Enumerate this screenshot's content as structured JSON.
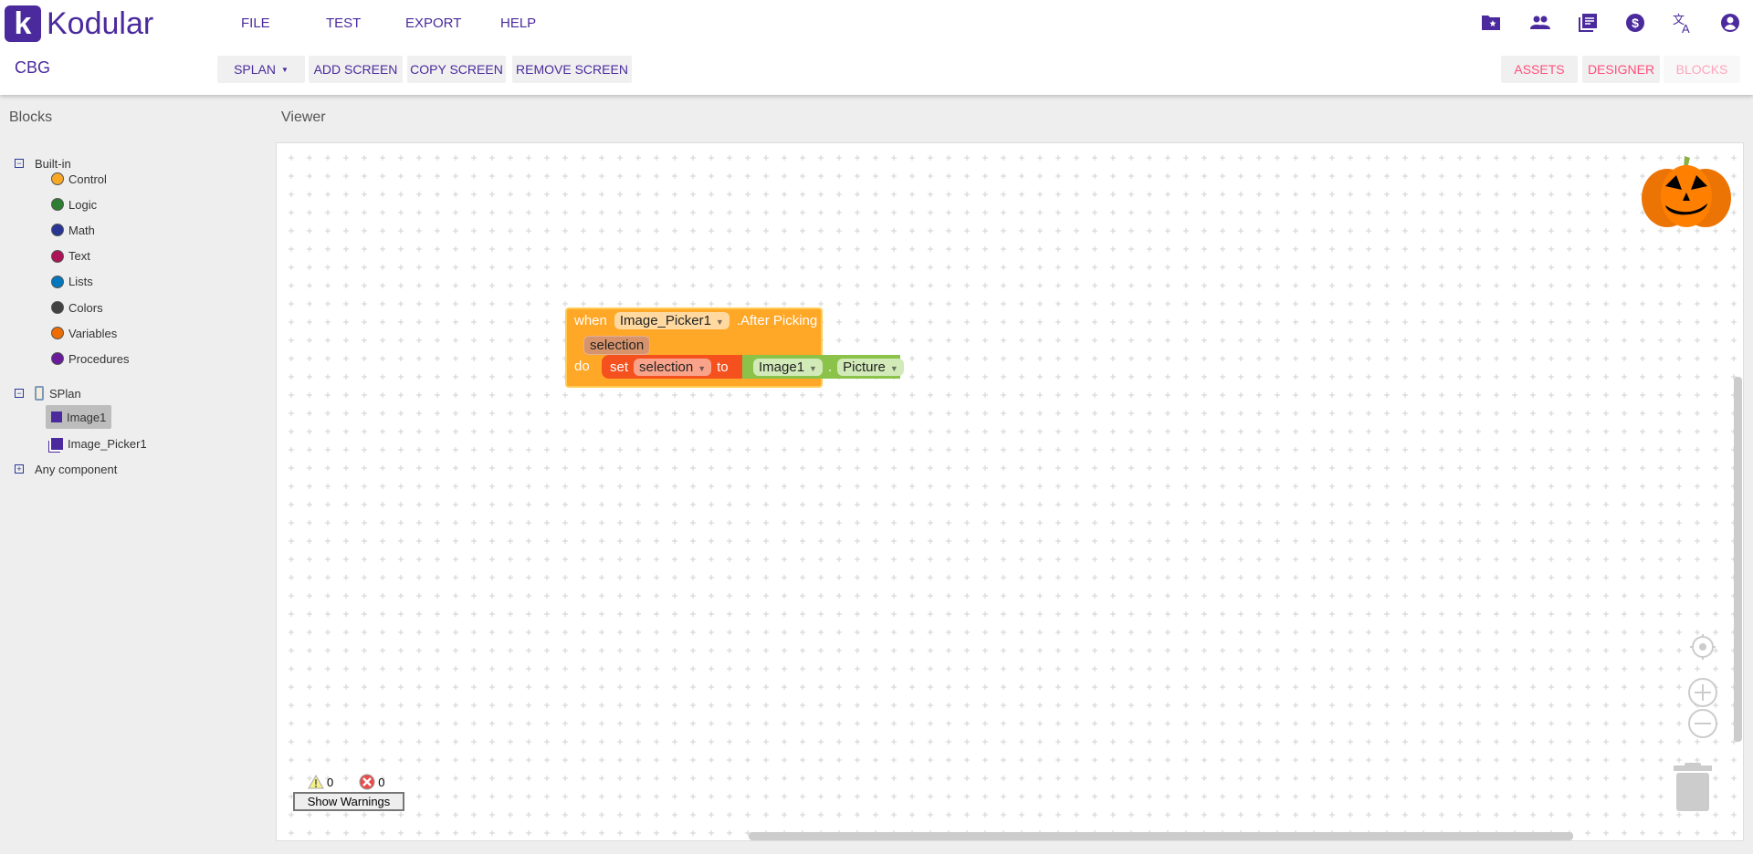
{
  "header": {
    "logo_text": "Kodular",
    "menu": [
      "FILE",
      "TEST",
      "EXPORT",
      "HELP"
    ],
    "project": "CBG",
    "screen_select": "SPLAN",
    "add_screen": "ADD SCREEN",
    "copy_screen": "COPY SCREEN",
    "remove_screen": "REMOVE SCREEN",
    "assets": "ASSETS",
    "designer": "DESIGNER",
    "blocks": "BLOCKS",
    "icons": [
      "folder-star-icon",
      "people-icon",
      "library-icon",
      "dollar-icon",
      "translate-icon",
      "account-icon"
    ]
  },
  "sidebar": {
    "title": "Blocks",
    "builtin": "Built-in",
    "categories": [
      {
        "label": "Control",
        "color": "#f9a825"
      },
      {
        "label": "Logic",
        "color": "#2e7d32"
      },
      {
        "label": "Math",
        "color": "#283593"
      },
      {
        "label": "Text",
        "color": "#ad1457"
      },
      {
        "label": "Lists",
        "color": "#0277bd"
      },
      {
        "label": "Colors",
        "color": "#424242"
      },
      {
        "label": "Variables",
        "color": "#ef6c00"
      },
      {
        "label": "Procedures",
        "color": "#6a1b9a"
      }
    ],
    "screen": "SPlan",
    "components": [
      "Image1",
      "Image_Picker1"
    ],
    "any": "Any component"
  },
  "viewer": {
    "title": "Viewer",
    "block": {
      "when": "when",
      "component": "Image_Picker1",
      "event": ".After Picking",
      "param": "selection",
      "do": "do",
      "set": "set",
      "var": "selection",
      "to": "to",
      "getter_comp": "Image1",
      "dot": ".",
      "getter_prop": "Picture"
    },
    "warnings": "0",
    "errors": "0",
    "show_warnings": "Show Warnings"
  }
}
